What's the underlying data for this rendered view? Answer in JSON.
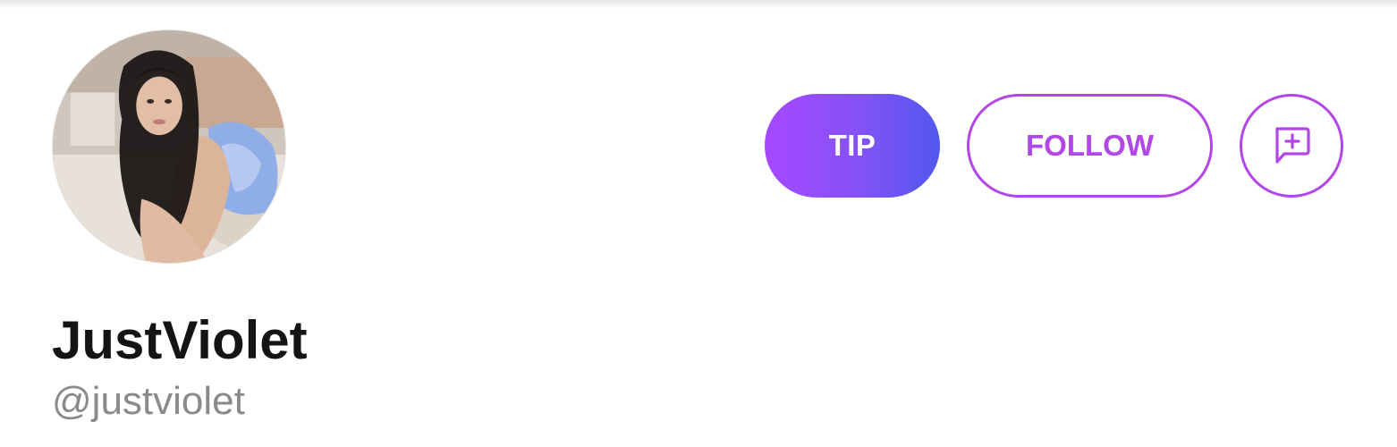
{
  "profile": {
    "display_name": "JustViolet",
    "username": "@justviolet",
    "avatar_icon": "profile-photo"
  },
  "actions": {
    "tip_label": "TIP",
    "follow_label": "FOLLOW",
    "message_icon": "chat-add-icon"
  },
  "colors": {
    "accent": "#b246e6",
    "tip_gradient_start": "#a648ff",
    "tip_gradient_end": "#5058ee",
    "name_text": "#141414",
    "username_text": "#8a8a8a"
  }
}
